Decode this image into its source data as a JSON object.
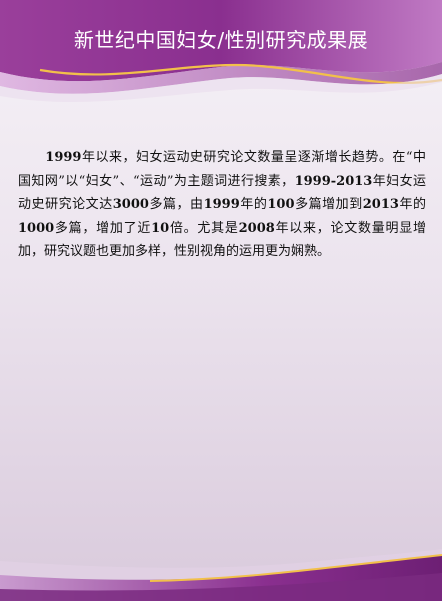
{
  "header": {
    "title": "新世纪中国妇女/性别研究成果展"
  },
  "body": {
    "s1": "1999",
    "s2": "年以来，妇女运动史研究论文数量呈逐渐增长趋势。在“中国知网”以“妇女”、“运动”为主题词进行搜素，",
    "s3": "1999-2013",
    "s4": "年妇女运动史研究论文达",
    "s5": "3000",
    "s6": "多篇，由",
    "s7": "1999",
    "s8": "年的",
    "s9": "100",
    "s10": "多篇增加到",
    "s11": "2013",
    "s12": "年的",
    "s13": "1000",
    "s14": "多篇，增加了近",
    "s15": "10",
    "s16": "倍。尤其是",
    "s17": "2008",
    "s18": "年以来，论文数量明显增加，研究议题也更加多样，性别视角的运用更为娴熟。"
  },
  "colors": {
    "banner_purple": "#8a2f8f",
    "banner_light": "#b46bb8",
    "accent_gold": "#f2c04a",
    "background": "#ece4ee"
  }
}
